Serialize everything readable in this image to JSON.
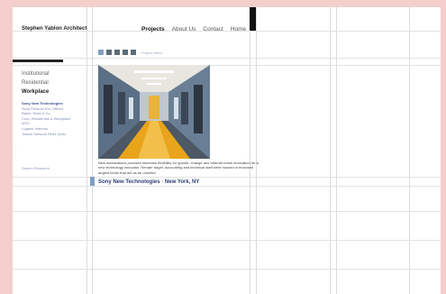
{
  "site": {
    "brand": "Stephen Yablon Architect"
  },
  "nav": {
    "items": [
      {
        "label": "Projects",
        "active": true
      },
      {
        "label": "About Us",
        "active": false
      },
      {
        "label": "Contact",
        "active": false
      },
      {
        "label": "Home",
        "active": false
      }
    ]
  },
  "sidebar": {
    "categories": [
      {
        "label": "Institutional",
        "active": false
      },
      {
        "label": "Residential",
        "active": false
      },
      {
        "label": "Workplace",
        "active": true
      }
    ],
    "projects": [
      {
        "label": "Sony New Technologies",
        "active": true
      },
      {
        "label": "Sony Pictures Ent. Offices",
        "active": false
      },
      {
        "label": "Baker, Botts & Co.",
        "active": false
      },
      {
        "label": "Corp. Residential & Workplace",
        "active": false
      },
      {
        "label": "W2S",
        "active": false
      },
      {
        "label": "Lugano Interiors",
        "active": false
      },
      {
        "label": "Yablon Network Fiber Optic",
        "active": false
      }
    ],
    "search_link": "Search Research"
  },
  "gallery": {
    "thumbnail_count": 5,
    "selected_index": 0,
    "thumbs_link": "Project Menu"
  },
  "main": {
    "description": "New workstations provided immense flexibility for growth, change and Internet crash renovation for a new technology innovator. Render target, accounting and technical staff were housed in enclosed angled forms that act as an unrolled",
    "caption_project": "Sony New Technologies",
    "caption_location": "New York, NY"
  },
  "colors": {
    "background": "#f4cfcc",
    "page": "#ffffff",
    "accent": "#2c3e74",
    "floor": "#e8a41a"
  }
}
